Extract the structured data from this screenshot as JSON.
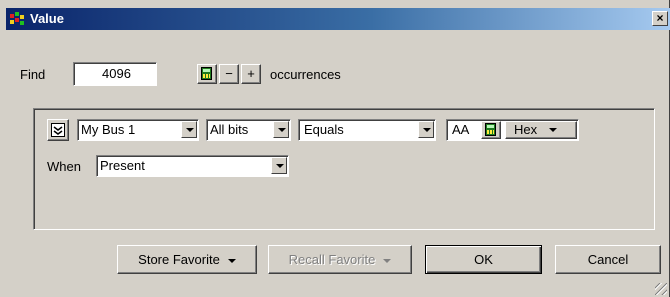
{
  "window": {
    "title": "Value",
    "close_glyph": "×"
  },
  "find": {
    "label": "Find",
    "count_value": "4096",
    "minus_label": "−",
    "plus_label": "+",
    "suffix_label": "occurrences"
  },
  "condition": {
    "bus_select": "My Bus 1",
    "bits_select": "All bits",
    "operator_select": "Equals",
    "value_input": "AA",
    "format_select": "Hex",
    "when_label": "When",
    "when_select": "Present"
  },
  "buttons": {
    "store_favorite": "Store Favorite",
    "recall_favorite": "Recall Favorite",
    "ok": "OK",
    "cancel": "Cancel"
  },
  "icons": {
    "app": "logic-analyzer-icon",
    "calculator": "calculator-icon",
    "toggle": "collapse-toggle-icon"
  },
  "colors": {
    "titlebar_start": "#0a246a",
    "titlebar_end": "#a6caf0",
    "dialog_face": "#d4d0c8"
  }
}
